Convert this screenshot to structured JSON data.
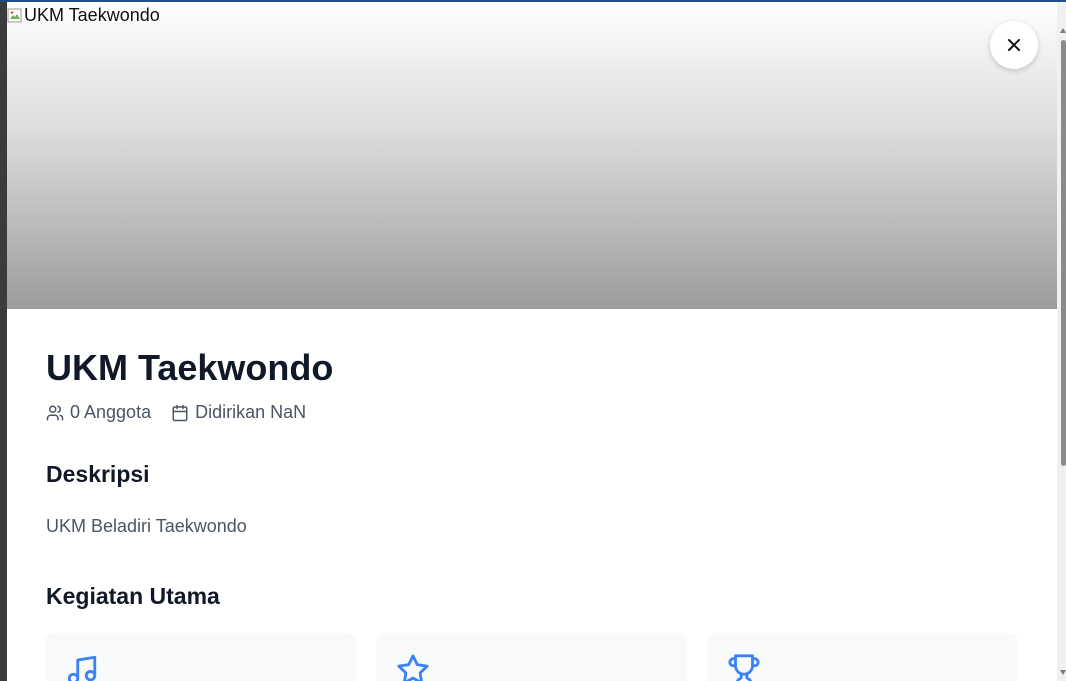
{
  "hero": {
    "image_alt": "UKM Taekwondo",
    "faint_close_glyph": "×"
  },
  "close_button": {
    "icon": "close-icon"
  },
  "club": {
    "name": "UKM Taekwondo",
    "members": "0 Anggota",
    "founded": "Didirikan NaN"
  },
  "sections": {
    "description_title": "Deskripsi",
    "description_text": "UKM Beladiri Taekwondo",
    "activities_title": "Kegiatan Utama"
  },
  "activities": [
    {
      "icon": "music-icon"
    },
    {
      "icon": "star-icon"
    },
    {
      "icon": "trophy-icon"
    }
  ],
  "colors": {
    "accent": "#3b82f6",
    "title": "#111827",
    "muted": "#4b5563",
    "card_bg": "#f9fafb"
  }
}
